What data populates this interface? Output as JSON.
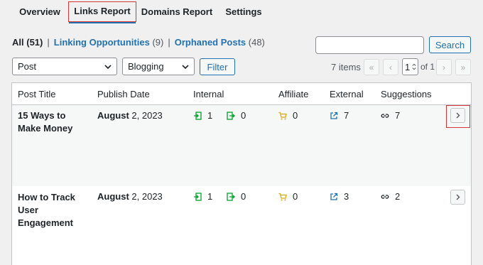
{
  "tabs": [
    {
      "label": "Overview"
    },
    {
      "label": "Links Report"
    },
    {
      "label": "Domains Report"
    },
    {
      "label": "Settings"
    }
  ],
  "status_links": {
    "all_label": "All",
    "all_count": "(51)",
    "opportunities_label": "Linking Opportunities",
    "opportunities_count": "(9)",
    "orphaned_label": "Orphaned Posts",
    "orphaned_count": "(48)",
    "separator": "|"
  },
  "search": {
    "button_label": "Search",
    "value": ""
  },
  "filters": {
    "post_type": "Post",
    "category": "Blogging",
    "filter_button": "Filter"
  },
  "pagination": {
    "items": "7 items",
    "first": "«",
    "prev": "‹",
    "next": "›",
    "last": "»",
    "current_page": "1",
    "of_label": "of 1"
  },
  "columns": [
    "Post Title",
    "Publish Date",
    "Internal",
    "Affiliate",
    "External",
    "Suggestions"
  ],
  "rows": [
    {
      "title": "15 Ways to Make Money",
      "month_day": "August",
      "rest": "2, 2023",
      "internal_in": "1",
      "internal_out": "0",
      "affiliate": "0",
      "external": "7",
      "suggestions": "7"
    },
    {
      "title": "How to Track User Engagement",
      "month_day": "August",
      "rest": "2, 2023",
      "internal_in": "1",
      "internal_out": "0",
      "affiliate": "0",
      "external": "3",
      "suggestions": "2"
    }
  ],
  "colors": {
    "accent": "#2271b1",
    "highlight": "#d63638",
    "internal": "#00a32a",
    "affiliate": "#dba617"
  }
}
